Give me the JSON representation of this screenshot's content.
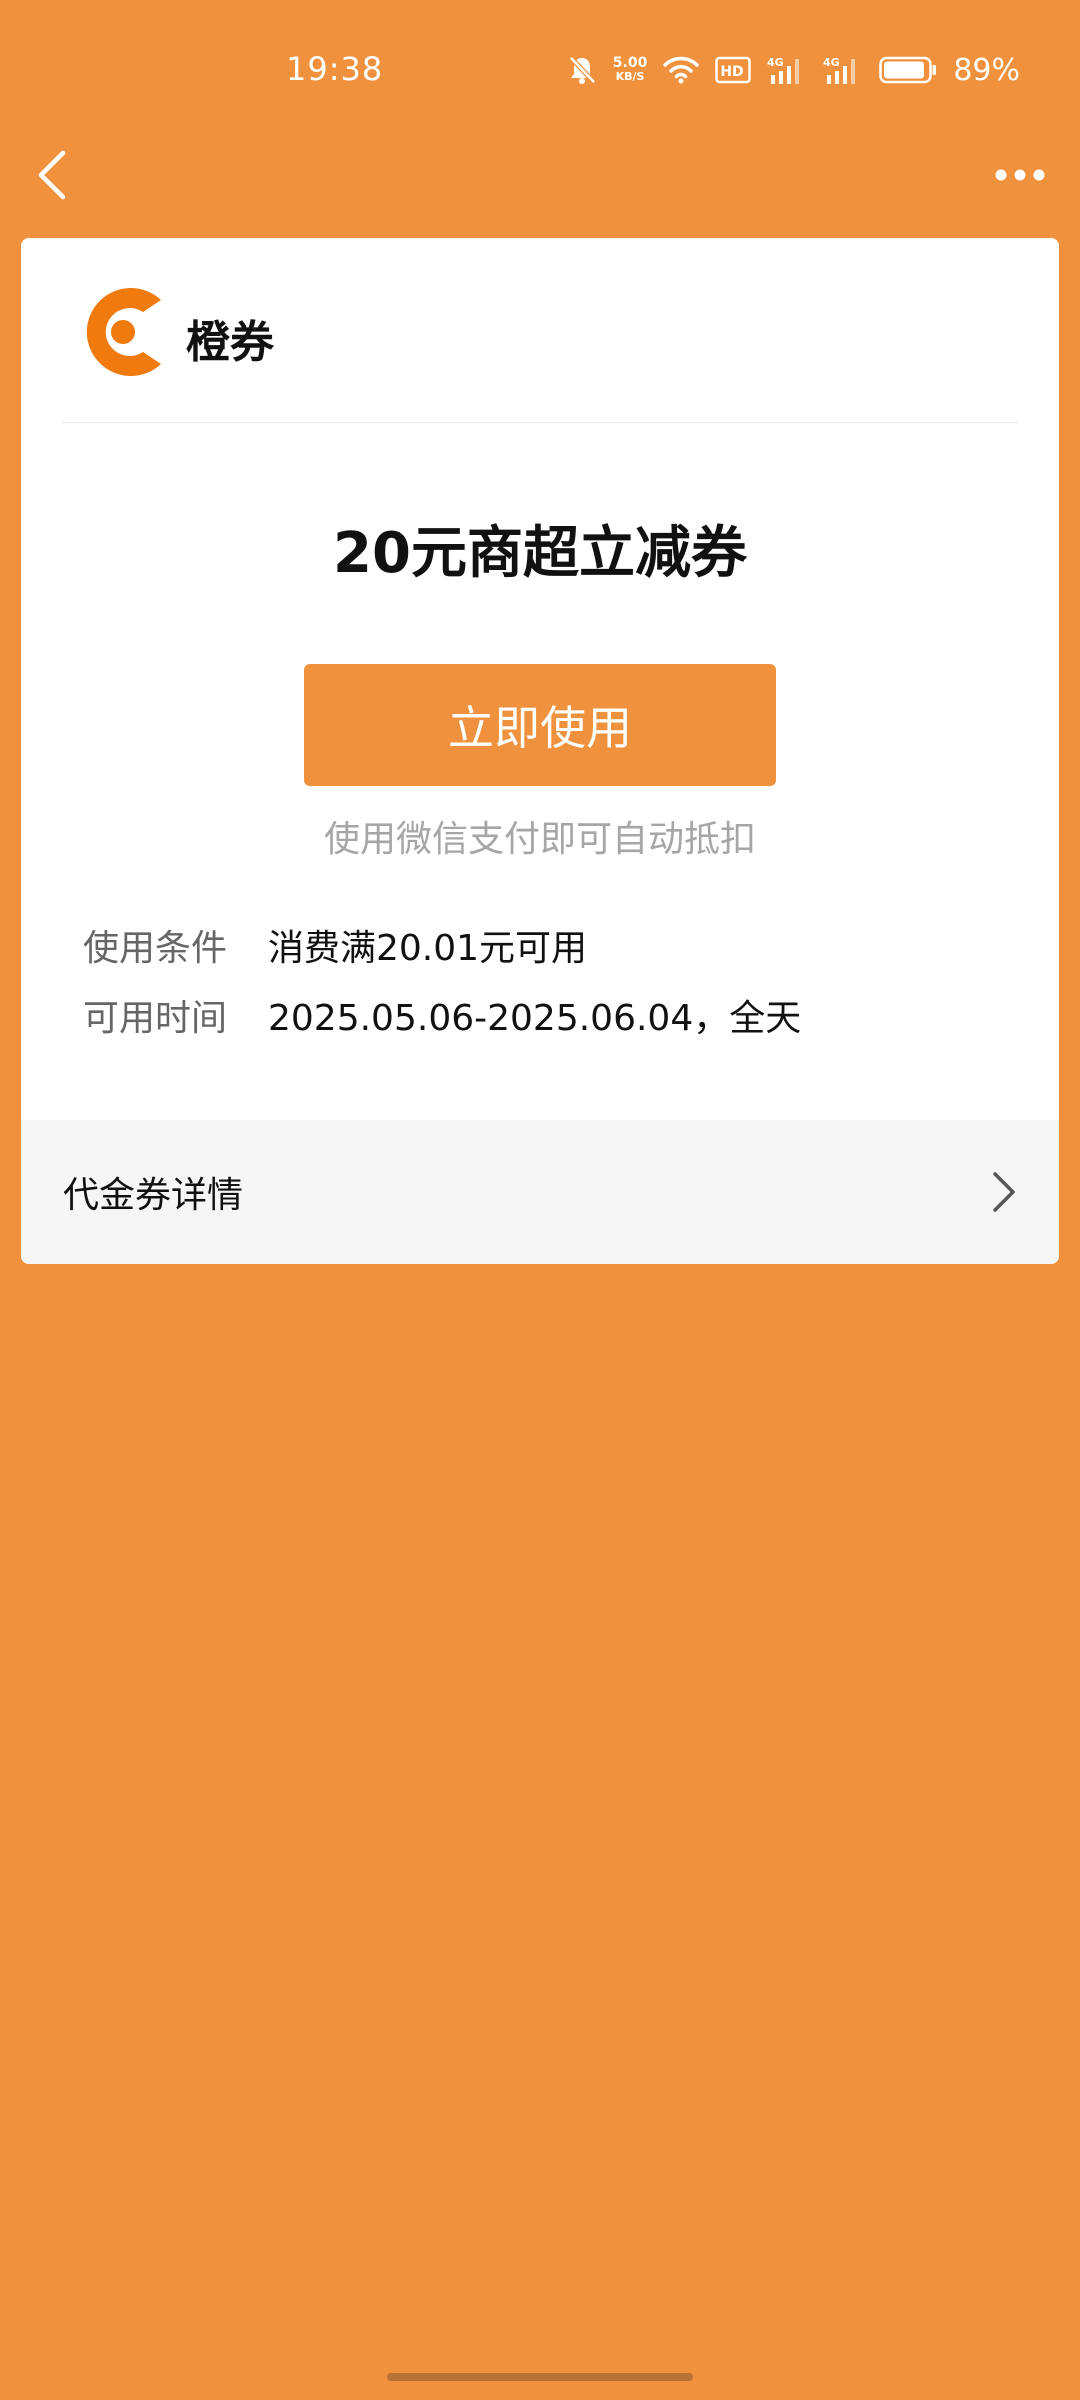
{
  "status_bar": {
    "time": "19:38",
    "net_speed_value": "5.00",
    "net_speed_unit": "KB/S",
    "hd_label": "HD",
    "sim1_label": "4G",
    "sim2_label": "4G",
    "battery_percent": "89%"
  },
  "brand": {
    "name": "橙券",
    "logo_icon": "orange-c-logo-icon",
    "color": "#F07A0E"
  },
  "coupon": {
    "title": "20元商超立减券",
    "use_button_label": "立即使用",
    "hint": "使用微信支付即可自动抵扣",
    "conditions": [
      {
        "label": "使用条件",
        "value": "消费满20.01元可用"
      },
      {
        "label": "可用时间",
        "value": "2025.05.06-2025.06.04，全天"
      }
    ],
    "detail_label": "代金券详情"
  },
  "colors": {
    "accent": "#F0913D",
    "card": "#FFFFFF",
    "detail_bg": "#F6F6F6"
  }
}
